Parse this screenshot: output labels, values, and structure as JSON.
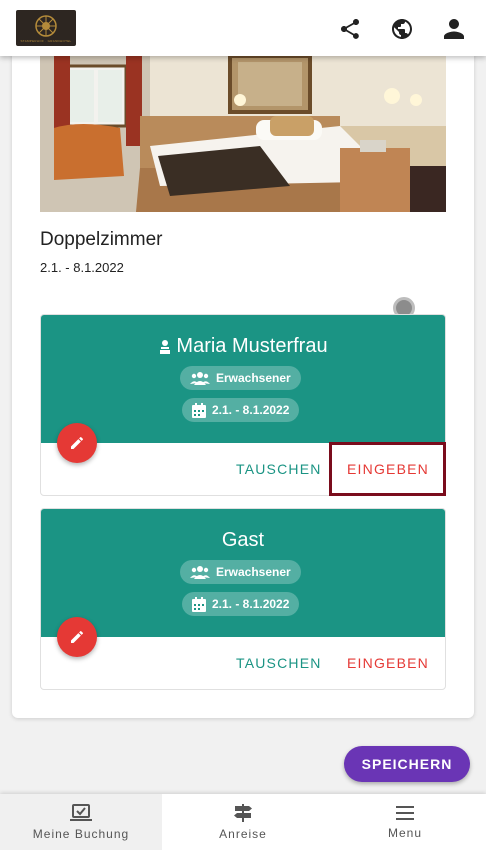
{
  "header": {
    "logo_text": "STAMPERHOF · GRANDHOTEL",
    "icons": [
      "share-icon",
      "globe-icon",
      "account-icon"
    ]
  },
  "room": {
    "title": "Doppelzimmer",
    "dates": "2.1. - 8.1.2022"
  },
  "guests": [
    {
      "name": "Maria Musterfrau",
      "type": "Erwachsener",
      "dates": "2.1. - 8.1.2022",
      "swap_label": "TAUSCHEN",
      "enter_label": "EINGEBEN"
    },
    {
      "name": "Gast",
      "type": "Erwachsener",
      "dates": "2.1. - 8.1.2022",
      "swap_label": "TAUSCHEN",
      "enter_label": "EINGEBEN"
    }
  ],
  "save_label": "SPEICHERN",
  "bottom_nav": [
    {
      "label": "Meine Buchung",
      "icon": "booking-icon",
      "active": true
    },
    {
      "label": "Anreise",
      "icon": "signpost-icon",
      "active": false
    },
    {
      "label": "Menu",
      "icon": "menu-icon",
      "active": false
    }
  ],
  "colors": {
    "teal": "#1b9484",
    "red": "#e53935",
    "purple": "#6a35b5",
    "highlight": "#7a0c1c"
  }
}
